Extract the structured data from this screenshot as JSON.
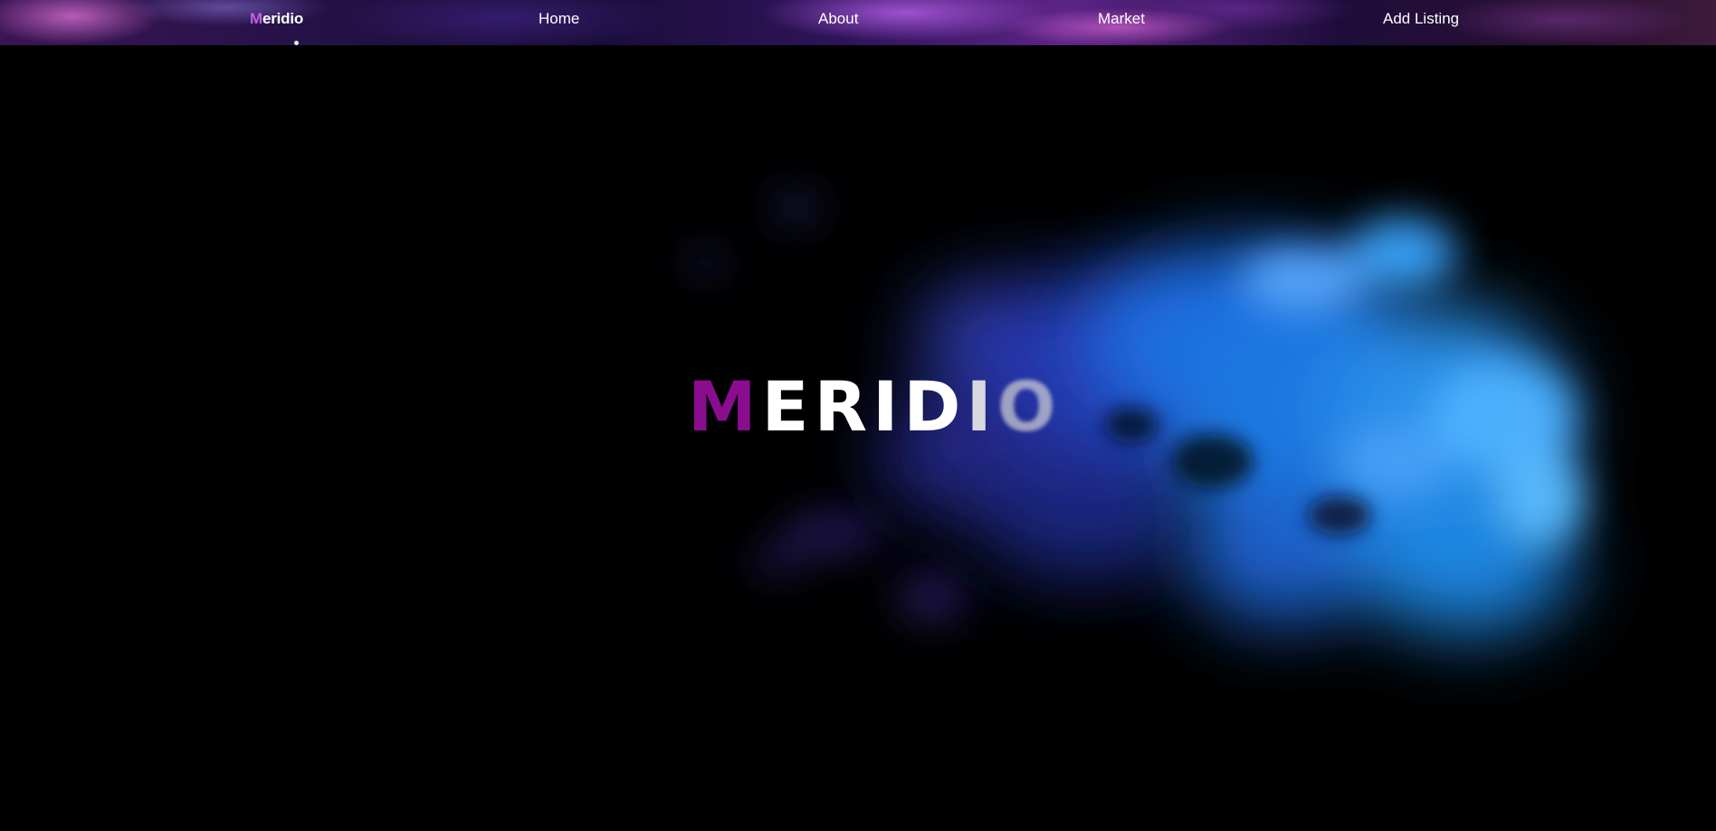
{
  "nav": {
    "brand": {
      "first_letter": "M",
      "rest": "eridio"
    },
    "items": [
      {
        "label": "Home"
      },
      {
        "label": "About"
      },
      {
        "label": "Market"
      },
      {
        "label": "Add Listing"
      }
    ]
  },
  "hero": {
    "title_letters": [
      "M",
      "E",
      "R",
      "I",
      "D",
      "I",
      "O"
    ]
  },
  "colors": {
    "brand_accent": "#c060e8",
    "title_accent": "#8a0d8f",
    "background": "#000000",
    "smoke_blue": "#2a8fe8"
  }
}
